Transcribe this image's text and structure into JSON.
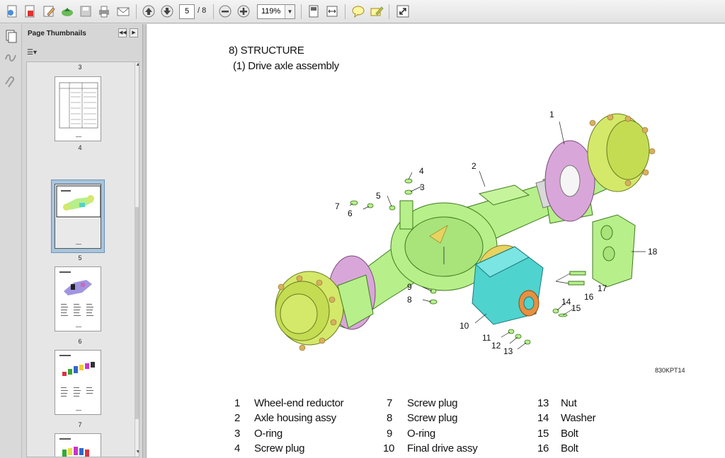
{
  "toolbar": {
    "page_current": "5",
    "page_total": "/ 8",
    "zoom": "119%"
  },
  "panel": {
    "title": "Page Thumbnails",
    "thumbnails": [
      {
        "label": "3"
      },
      {
        "label": "4"
      },
      {
        "label": "5"
      },
      {
        "label": "6"
      },
      {
        "label": "7"
      }
    ]
  },
  "document": {
    "section_title": "8) STRUCTURE",
    "subtitle": "(1)  Drive axle assembly",
    "figure_code": "830KPT14",
    "callouts": [
      "1",
      "2",
      "3",
      "4",
      "5",
      "6",
      "7",
      "8",
      "9",
      "10",
      "11",
      "12",
      "13",
      "14",
      "15",
      "16",
      "17",
      "18"
    ],
    "legend": [
      {
        "num": "1",
        "text": "Wheel-end reductor"
      },
      {
        "num": "2",
        "text": "Axle housing assy"
      },
      {
        "num": "3",
        "text": "O-ring"
      },
      {
        "num": "4",
        "text": "Screw plug"
      },
      {
        "num": "7",
        "text": "Screw plug"
      },
      {
        "num": "8",
        "text": "Screw plug"
      },
      {
        "num": "9",
        "text": "O-ring"
      },
      {
        "num": "10",
        "text": "Final drive assy"
      },
      {
        "num": "13",
        "text": "Nut"
      },
      {
        "num": "14",
        "text": "Washer"
      },
      {
        "num": "15",
        "text": "Bolt"
      },
      {
        "num": "16",
        "text": "Bolt"
      }
    ]
  },
  "colors": {
    "housing": "#b7ef8a",
    "disc": "#d9a6d9",
    "hub": "#d4e86a",
    "final_drive": "#4fd3cf",
    "selection": "#a8c4dd"
  }
}
